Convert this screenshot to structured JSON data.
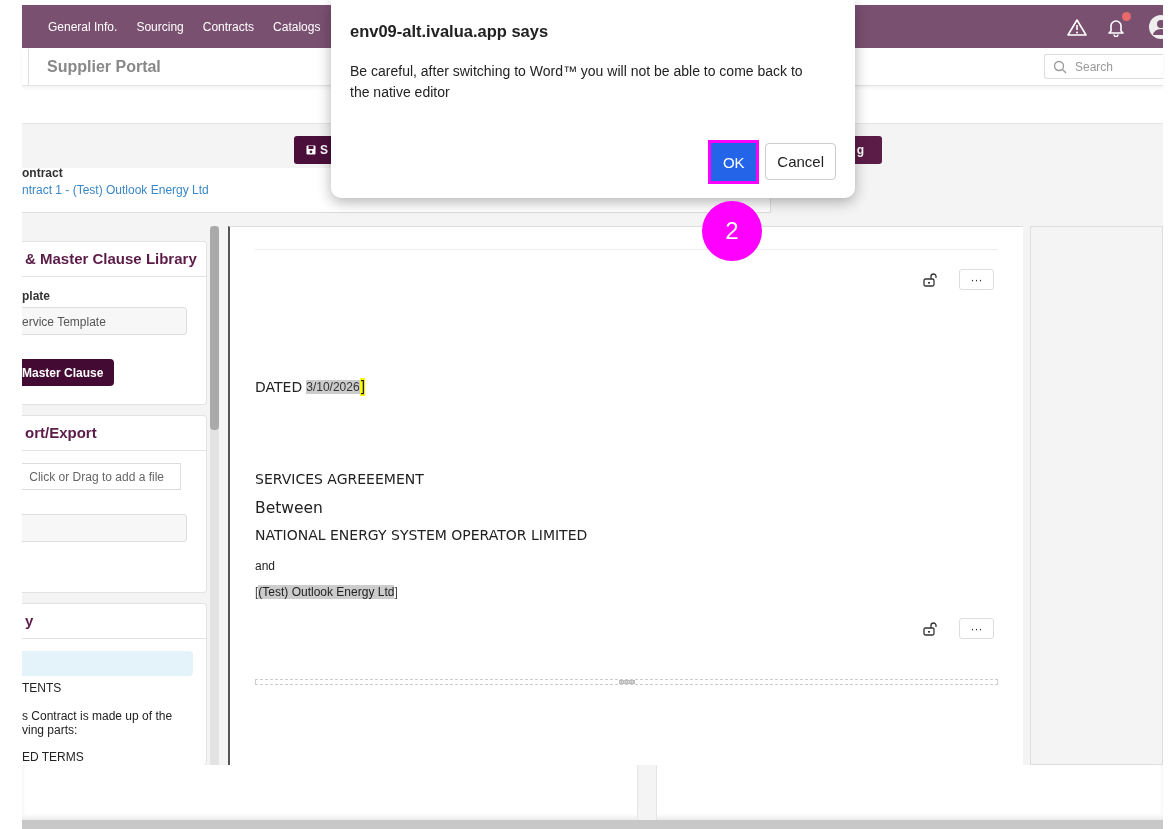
{
  "nav": {
    "items": [
      "General Info.",
      "Sourcing",
      "Contracts",
      "Catalogs"
    ],
    "notification_dot": true
  },
  "header": {
    "title": "Supplier Portal",
    "search": {
      "placeholder": "Search"
    }
  },
  "toolbar": {
    "buttons": [
      {
        "kind": "save",
        "label": "S"
      },
      {
        "kind": "plain",
        "label": "g"
      }
    ]
  },
  "contract": {
    "label": "ontract",
    "link": "ntract 1 - (Test) Outlook Energy Ltd"
  },
  "side_panels": [
    {
      "title": "& Master Clause Library",
      "rows": [
        {
          "kind": "label",
          "text": "plate"
        },
        {
          "kind": "field",
          "value": "ervice Template"
        },
        {
          "kind": "button",
          "text": "Master Clause"
        }
      ]
    },
    {
      "title": "ort/Export",
      "rows": [
        {
          "kind": "file",
          "text": "Click or Drag to add a file"
        },
        {
          "kind": "field"
        }
      ]
    },
    {
      "title": "y",
      "rows": [
        {
          "kind": "highlight"
        },
        {
          "kind": "text",
          "text": "TENTS"
        },
        {
          "kind": "text",
          "text": "s Contract is made up of the"
        },
        {
          "kind": "text",
          "text": "ving parts:"
        },
        {
          "kind": "text",
          "text": "ED TERMS"
        }
      ]
    }
  ],
  "document": {
    "menus": [
      "···",
      "···"
    ],
    "lines": [
      {
        "kind": "date",
        "text": "DATED",
        "value": "3/10/2026",
        "close": "]"
      },
      {
        "kind": "title",
        "text": "SERVICES AGREEEMENT"
      },
      {
        "kind": "large",
        "text": "Between"
      },
      {
        "kind": "title",
        "text": "NATIONAL ENERGY SYSTEM OPERATOR LIMITED"
      },
      {
        "kind": "small",
        "text": "and"
      },
      {
        "kind": "field",
        "open": "[",
        "value": "(Test) Outlook Energy Ltd",
        "close": "]"
      }
    ]
  },
  "dialog": {
    "title": "env09-alt.ivalua.app says",
    "message": "Be careful, after switching to Word™ you will not be able to come back to the native editor",
    "buttons": [
      {
        "kind": "primary",
        "label": "OK",
        "highlighted": true
      },
      {
        "kind": "secondary",
        "label": "Cancel",
        "highlighted": false
      }
    ]
  },
  "step_badge": "2"
}
